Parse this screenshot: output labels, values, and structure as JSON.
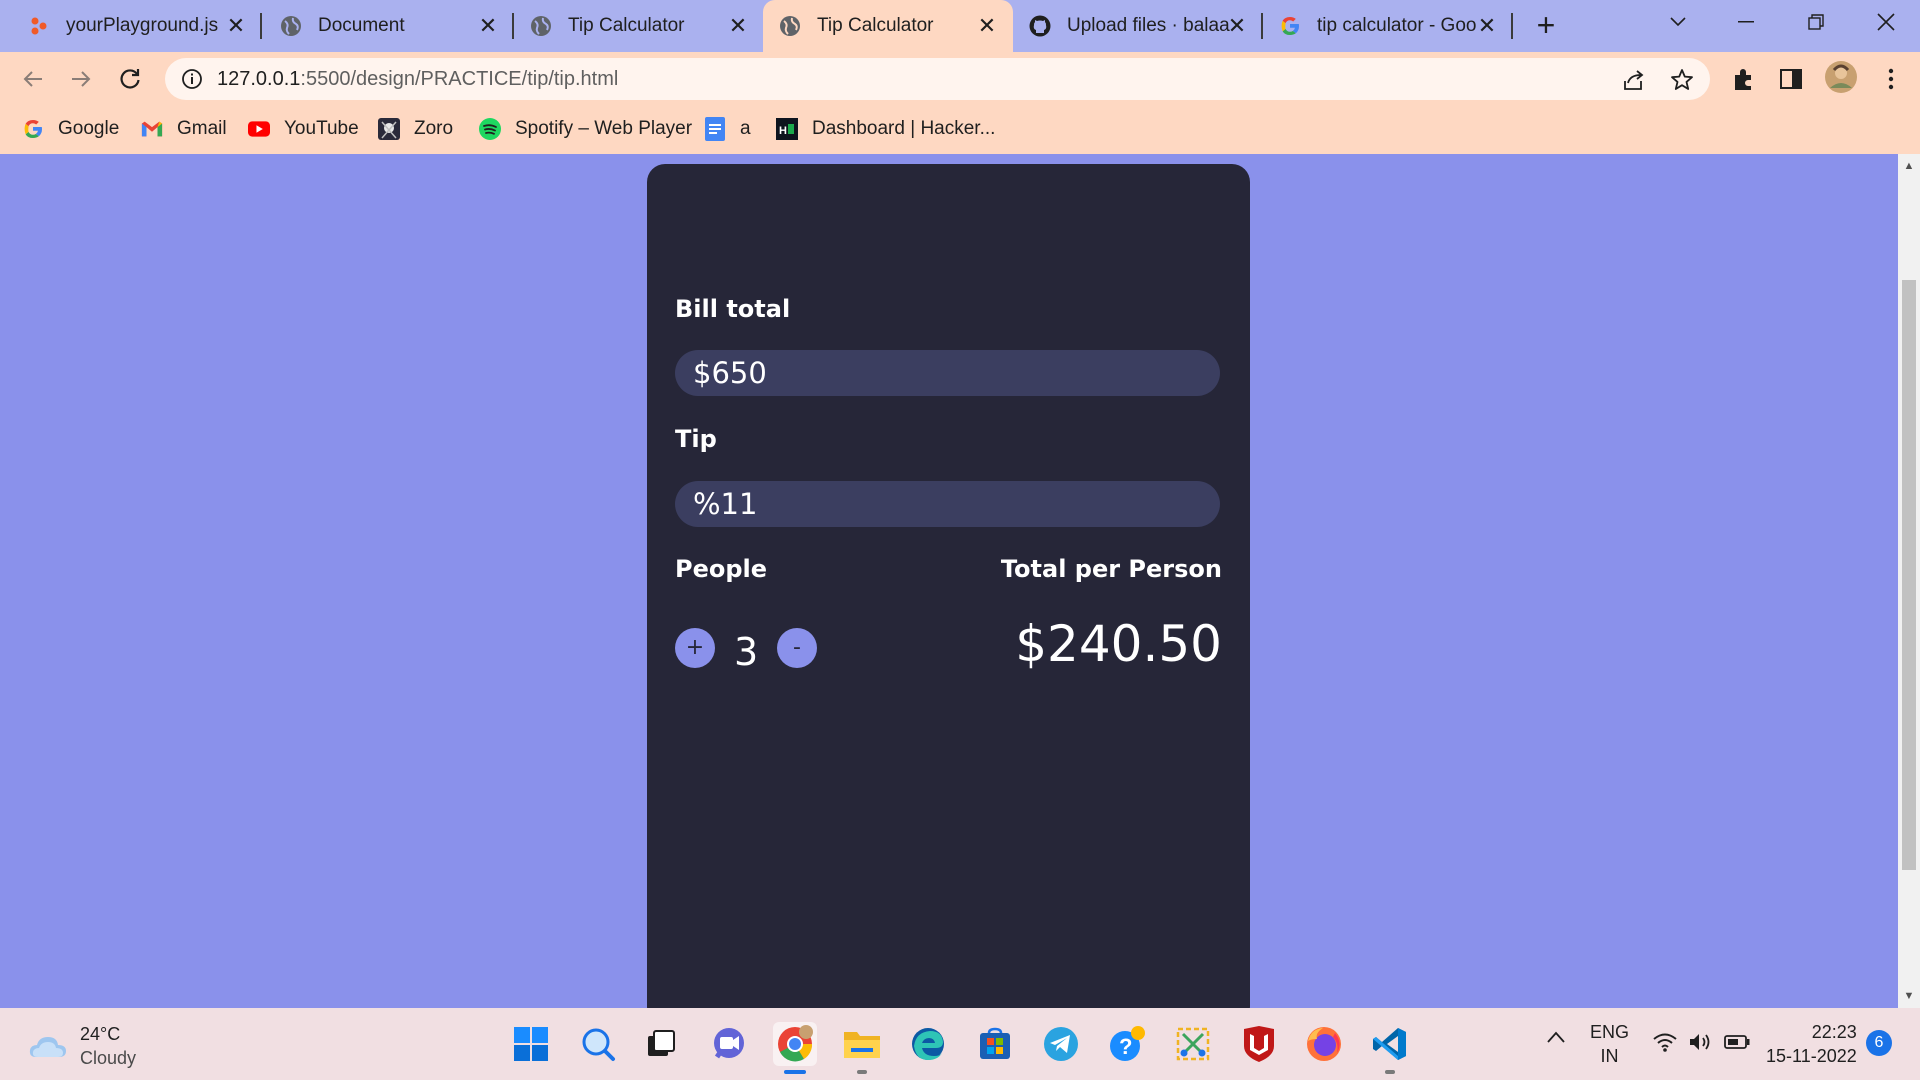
{
  "browser": {
    "tabs": [
      {
        "title": "yourPlayground.js",
        "icon": "playground-icon",
        "active": false
      },
      {
        "title": "Document",
        "icon": "globe-icon",
        "active": false
      },
      {
        "title": "Tip Calculator",
        "icon": "globe-icon",
        "active": false
      },
      {
        "title": "Tip Calculator",
        "icon": "globe-icon",
        "active": true
      },
      {
        "title": "Upload files · balaa",
        "icon": "github-icon",
        "active": false
      },
      {
        "title": "tip calculator - Goo",
        "icon": "google-icon",
        "active": false
      }
    ],
    "new_tab_label": "+",
    "url_host": "127.0.0.1",
    "url_rest": ":5500/design/PRACTICE/tip/tip.html",
    "bookmarks": [
      {
        "label": "Google",
        "icon": "google-icon"
      },
      {
        "label": "Gmail",
        "icon": "gmail-icon"
      },
      {
        "label": "YouTube",
        "icon": "youtube-icon"
      },
      {
        "label": "Zoro",
        "icon": "zoro-icon"
      },
      {
        "label": "Spotify – Web Player",
        "icon": "spotify-icon"
      },
      {
        "label": "a",
        "icon": "docs-icon"
      },
      {
        "label": "Dashboard | Hacker...",
        "icon": "hackerrank-icon"
      }
    ]
  },
  "calculator": {
    "bill_label": "Bill total",
    "bill_value": "$650",
    "tip_label": "Tip",
    "tip_value": "%11",
    "people_label": "People",
    "total_label": "Total per Person",
    "people_count": "3",
    "plus_label": "+",
    "minus_label": "-",
    "total_value": "$240.50"
  },
  "taskbar": {
    "weather_temp": "24°C",
    "weather_desc": "Cloudy",
    "lang_top": "ENG",
    "lang_bottom": "IN",
    "time": "22:23",
    "date": "15-11-2022",
    "notification_count": "6"
  },
  "colors": {
    "page_bg": "#8a91eb",
    "card_bg": "#262638",
    "field_bg": "#3b3e60",
    "accent": "#8a91eb",
    "active_tab": "#fed8c2"
  }
}
